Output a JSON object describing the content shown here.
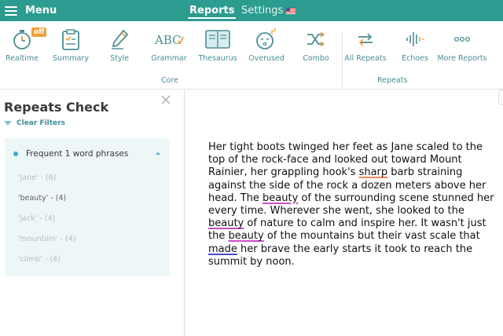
{
  "topbar": {
    "menu_label": "Menu",
    "tabs": [
      {
        "label": "Reports"
      },
      {
        "label": "Settings"
      }
    ],
    "colors": {
      "bar": "#2b9c8f"
    }
  },
  "toolbar": {
    "core_tools": [
      {
        "label": "Realtime",
        "icon": "stopwatch-icon",
        "badge": "off"
      },
      {
        "label": "Summary",
        "icon": "clipboard-icon"
      },
      {
        "label": "Style",
        "icon": "pen-icon"
      },
      {
        "label": "Grammar",
        "icon": "abc-check-icon"
      },
      {
        "label": "Thesaurus",
        "icon": "book-icon"
      },
      {
        "label": "Overused",
        "icon": "sleepy-face-icon"
      },
      {
        "label": "Combo",
        "icon": "shuffle-icon"
      }
    ],
    "repeat_tools": [
      {
        "label": "All Repeats",
        "icon": "repeat-arrows-icon"
      },
      {
        "label": "Echoes",
        "icon": "soundwave-icon"
      },
      {
        "label": "More Reports",
        "icon": "more-dots-icon"
      }
    ],
    "groups": {
      "core": "Core",
      "repeats": "Repeats"
    }
  },
  "left_panel": {
    "title": "Repeats Check",
    "clear_filters": "Clear Filters",
    "phrase_group": {
      "title": "Frequent 1 word phrases",
      "items": [
        {
          "label": "'jane' - (6)"
        },
        {
          "label": "'beauty' - (4)"
        },
        {
          "label": "'jack' - (4)"
        },
        {
          "label": "'mountain' - (4)"
        },
        {
          "label": "'climb' - (4)"
        }
      ]
    }
  },
  "editor": {
    "lines": [
      "Her tight boots twinged her feet as Jane scaled to the",
      "top of the rock-face and looked out toward Mount",
      "Rainier, her grappling hook's sharp barb straining",
      "against the side of the rock a dozen meters above her",
      "head. The beauty of the surrounding scene stunned her",
      "every time. Wherever she went, she looked to the",
      "beauty of nature to calm and inspire her. It wasn't just",
      "the beauty of the mountains but their vast scale that",
      "made her brave the early starts it took to reach the",
      "summit by noon."
    ]
  },
  "colors": {
    "accent": "#2b9c8f",
    "label": "#4b8e96",
    "highlight_orange": "#f08c5a",
    "highlight_pink": "#c850c8",
    "highlight_blue": "#4a4ad0"
  }
}
